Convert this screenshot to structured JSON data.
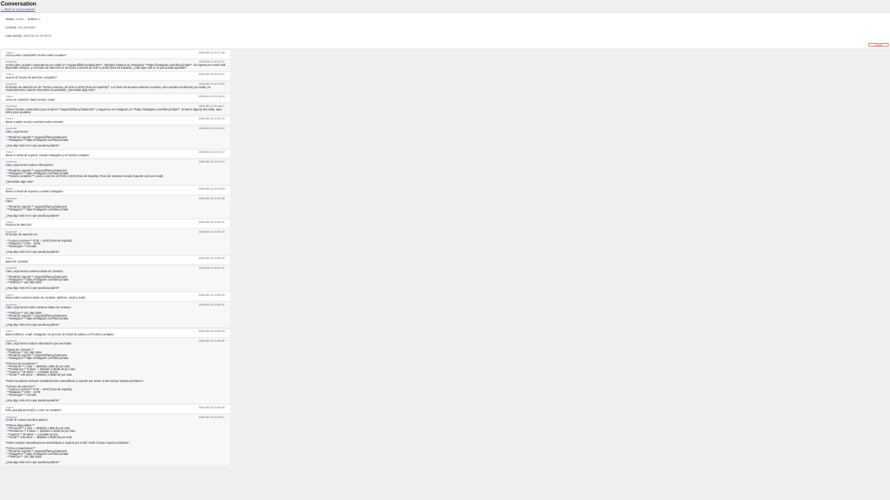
{
  "header": {
    "title": "Conversation",
    "back_link": "← Back to Conversations"
  },
  "status_panel": {
    "status_label": "Status:",
    "status_value": "Active",
    "strikes_label": "Strikes:",
    "strikes_value": "0",
    "contact_label": "Contact:",
    "contact_value": "Not provided",
    "last_activity_label": "Last activity:",
    "last_activity_value": "2026-08-12 02:49:27",
    "delete_label": "Delete"
  },
  "messages": [
    {
      "role": "visitor",
      "who": "Visitor",
      "ts": "2026-08-12 02:17:36",
      "text": "como puedo contactarle? tenéis redes sociales?"
    },
    {
      "role": "assistant",
      "who": "Assistant",
      "ts": "2026-08-12 02:11:37",
      "text": "¡Hola! Claro, puedes contactarnos por email en **support@fancychatai.test**. También estamos en Instagram: **https://instagram.com/fancychatai**. El soporte por email está disponible siempre, y el horario de atención es de lunes a viernes de 9:00 a 18:00 (hora de España). ¿Hay algo más en lo que pueda ayudarte?"
    },
    {
      "role": "visitor",
      "who": "Visitor",
      "ts": "2026-08-12 02:19:57",
      "text": "cual es el horario de atencion completo?"
    },
    {
      "role": "assistant",
      "who": "Assistant",
      "ts": "2026-08-12 02:13:29",
      "text": "El horario de atención es de **lunes a viernes, de 9:00 a 18:00 (hora de España)**. Los fines de semana estamos cerrados, pero puedes escribirnos por email y te responderemos cuando retomemos la actividad. ¿Necesitas algo más?"
    },
    {
      "role": "visitor",
      "who": "Visitor",
      "ts": "2026-08-12 02:18:15",
      "text": "como os contacto? dame email y redes"
    },
    {
      "role": "assistant",
      "who": "Assistant",
      "ts": "2026-08-12 02:18:17",
      "text": "¡Claro! Puedes contactarnos por email en **support@fancychatai.test** y seguirnos en Instagram en **https://instagram.com/fancychatai**. Si tienes alguna otra duda, aquí estoy para ayudarte."
    },
    {
      "role": "visitor",
      "who": "Visitor",
      "ts": "2026-08-12 02:20:15",
      "text": "dame vuestro email y vuestras redes sociales"
    },
    {
      "role": "assistant",
      "who": "Assistant",
      "ts": "2026-08-12 02:20:16",
      "text": "Claro, aquí tienes:\n\n- **Email de soporte:** support@fancychatai.test\n- **Instagram:** https://instagram.com/fancychatai\n\n¿Hay algo más en lo que pueda ayudarte?"
    },
    {
      "role": "visitor",
      "who": "Visitor",
      "ts": "2026-08-12 02:21:17",
      "text": "dame el email de soporte, vuestro instagram y el horario completo"
    },
    {
      "role": "assistant",
      "who": "Assistant",
      "ts": "2026-08-12 02:21:19",
      "text": "Claro, aquí tienes toda la información:\n\n- **Email de soporte:** support@fancychatai.test\n- **Instagram:** https://instagram.com/fancychatai\n- **Horario completo:** Lunes a viernes de 9:00 a 18:00 (hora de España). Fines de semana cerrado (soporte solo por email).\n\n¿Necesitas algo más?"
    },
    {
      "role": "visitor",
      "who": "Visitor",
      "ts": "2026-08-12 02:23:34",
      "text": "dame el email de soporte y vuestro instagram"
    },
    {
      "role": "assistant",
      "who": "Assistant",
      "ts": "2026-08-12 02:23:35",
      "text": "Claro:\n\n- **Email de soporte:** support@fancychatai.test\n- **Instagram:** https://instagram.com/fancychatai\n\n¿Hay algo más en lo que pueda ayudarte?"
    },
    {
      "role": "visitor",
      "who": "Visitor",
      "ts": "2026-08-12 02:30:41",
      "text": "horarios de atención"
    },
    {
      "role": "assistant",
      "who": "Assistant",
      "ts": "2026-08-12 02:30:43",
      "text": "El horario de atención es:\n\n- **Lunes a viernes:** 9:00 – 18:00 (hora de España)\n- **Sábados:** 9:00 – 13:00\n- **Domingos:** Cerrado\n\n¿Hay algo más en lo que pueda ayudarte?"
    },
    {
      "role": "visitor",
      "who": "Visitor",
      "ts": "2026-08-12 02:31:09",
      "text": "datos de contacto"
    },
    {
      "role": "assistant",
      "who": "Assistant",
      "ts": "2026-08-12 02:31:11",
      "text": "Claro, aquí tienes nuestros datos de contacto:\n\n- **Email de soporte:** support@fancychatai.test\n- **Instagram:** https://instagram.com/fancychatai\n- **Teléfono:** 321 358 2525\n\n¿Hay algo más en lo que pueda ayudarte?"
    },
    {
      "role": "visitor",
      "who": "Visitor",
      "ts": "2026-08-12 02:36:29",
      "text": "dame todos vuestros datos de contacto: telefono, email y redes"
    },
    {
      "role": "assistant",
      "who": "Assistant",
      "ts": "2026-08-12 02:36:31",
      "text": "Claro, aquí tienes todos nuestros datos de contacto:\n\n- **Teléfono:** 321 358 2525\n- **Email de soporte:** support@fancychatai.test\n- **Instagram:** https://instagram.com/fancychatai\n\n¿Hay algo más en lo que pueda ayudarte?"
    },
    {
      "role": "visitor",
      "who": "Visitor",
      "ts": "2026-08-12 02:39:34",
      "text": "dame telefono, email, instagram, los precios de todos los planes y el horario completo"
    },
    {
      "role": "assistant",
      "who": "Assistant",
      "ts": "2026-08-12 02:39:36",
      "text": "Claro, aquí tienes toda la información que necesitas:\n\n**Datos de contacto:**\n- **Teléfono:** 321 358 2525\n- **Email de soporte:** support@fancychatai.test\n- **Instagram:** https://instagram.com/fancychatai\n\n**Precios de los planes:**\n- **Personal:** 1 sitio — $29/año o $69 de por vida.\n- **Freelancer:** 5 sitios — $45/año o $165 de por vida.\n- **Agency:** 25 sitios — consultar precio.\n- **Scale:** 100 sitios — $99/año o $299 de por vida.\n\n*Todos los planes incluyen actualizaciones automáticas y soporte por email. Scale incluye soporte prioritario.*\n\n**Horario de atención:**\n- **Lunes a viernes:** 9:00 – 18:00 (hora de España)\n- **Sábados:** 9:00 – 13:00\n- **Domingos:** Cerrado\n\n¿Hay algo más en lo que pueda ayudarte?"
    },
    {
      "role": "visitor",
      "who": "Visitor",
      "ts": "2026-08-12 02:49:25",
      "text": "hola, que planes tenéis y como os contacto?"
    },
    {
      "role": "assistant",
      "who": "Assistant",
      "ts": "2026-08-12 02:49:27",
      "text": "¡Hola! Te cuento nuestros planes:\n\n**Planes disponibles:**\n- **Personal:** 1 sitio — $29/año o $69 de por vida.\n- **Freelancer:** 5 sitios — $45/año o $165 de por vida.\n- **Agency:** 25 sitios — consultar precio.\n- **Scale:** 100 sitios — $99/año o $299 de por vida.\n\n*Todos incluyen actualizaciones automáticas y soporte por email. Scale incluye soporte prioritario.*\n\n**Cómo contactarnos:**\n- **Email de soporte:** support@fancychatai.test\n- **Instagram:** https://instagram.com/fancychatai\n- **Teléfono:** 321 358 2525\n\n¿Hay algo más en lo que pueda ayudarte?"
    }
  ],
  "colors": {
    "page_bg": "#efefef",
    "panel_bg": "#ffffff",
    "link": "#3b57c9",
    "delete": "#d33333",
    "sender": "#6c7fa5"
  }
}
